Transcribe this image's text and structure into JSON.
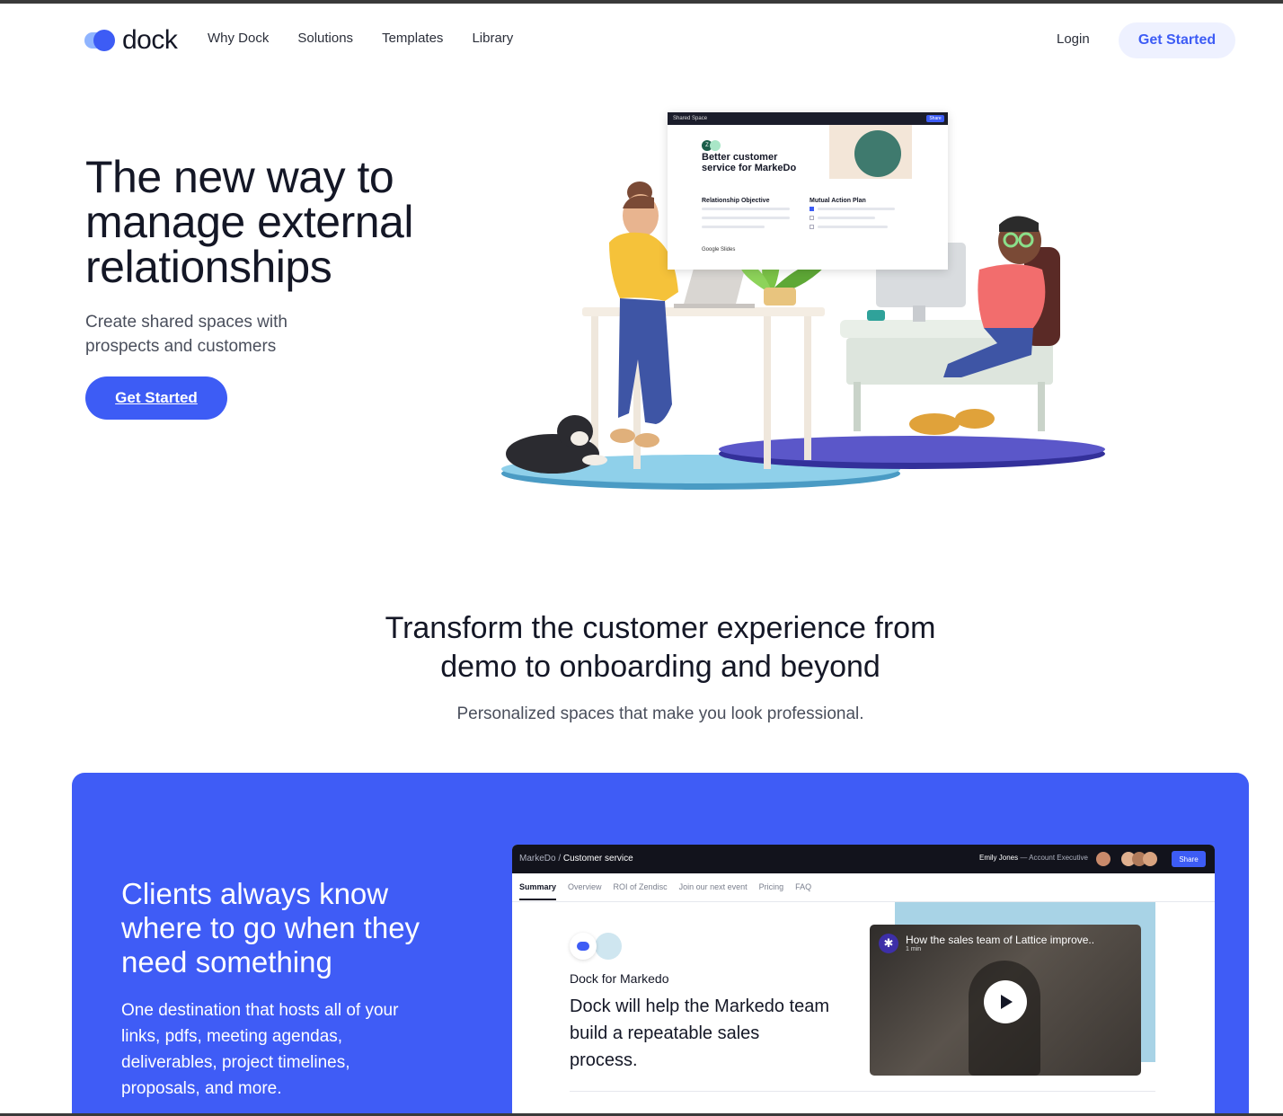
{
  "nav": {
    "logo_text": "dock",
    "links": [
      "Why Dock",
      "Solutions",
      "Templates",
      "Library"
    ],
    "login": "Login",
    "cta": "Get Started"
  },
  "hero": {
    "title": "The new way to manage external relationships",
    "subtitle": "Create shared spaces with prospects and customers",
    "cta": "Get Started"
  },
  "illustration": {
    "bar_label": "Shared Space",
    "share_label": "Share",
    "avatar_letter": "Z",
    "title": "Better customer service for MarkeDo",
    "col1": "Relationship Objective",
    "col2": "Mutual Action Plan",
    "footer": "Google Slides"
  },
  "section": {
    "title": "Transform the customer experience from demo to onboarding and beyond",
    "subtitle": "Personalized spaces that make you look professional."
  },
  "panel": {
    "title": "Clients always know where to go when they need something",
    "text": "One destination that hosts all of your links, pdfs, meeting agendas, deliverables, project timelines, proposals, and more."
  },
  "app": {
    "crumb_parent": "MarkeDo /",
    "crumb_current": " Customer service",
    "user_name": "Emily Jones",
    "user_role": " — Account Executive",
    "share": "Share",
    "tabs": [
      "Summary",
      "Overview",
      "ROI of Zendisc",
      "Join our next event",
      "Pricing",
      "FAQ"
    ],
    "company": "Dock for Markedo",
    "headline": "Dock will help the Markedo team build a repeatable sales process.",
    "video_title": "How the sales team of Lattice improve..",
    "video_duration": "1 min"
  },
  "colors": {
    "brand": "#3d5cf5",
    "panel": "#3f5cf6"
  }
}
